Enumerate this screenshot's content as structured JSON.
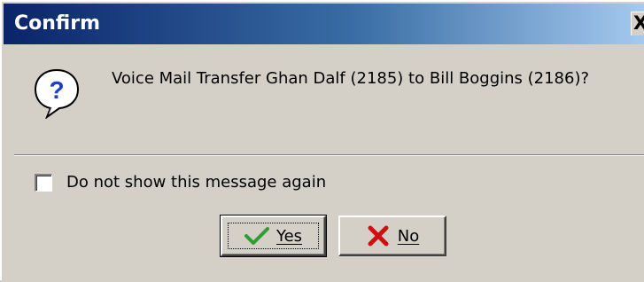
{
  "window": {
    "title": "Confirm",
    "close_glyph": "X"
  },
  "dialog": {
    "message": "Voice Mail Transfer Ghan Dalf (2185) to Bill Boggins (2186)?",
    "icon": "question-icon",
    "checkbox_label": "Do not show this message again",
    "checkbox_checked": false
  },
  "buttons": {
    "yes_label": "Yes",
    "yes_icon": "green-checkmark-icon",
    "no_label": "No",
    "no_icon": "red-x-icon"
  },
  "colors": {
    "titlebar_start": "#0a246a",
    "titlebar_end": "#a6caf0",
    "dialog_face": "#d4d0c8",
    "question_icon": "#1a3fd0",
    "check_green": "#2e9e2e",
    "x_red": "#d01010"
  }
}
